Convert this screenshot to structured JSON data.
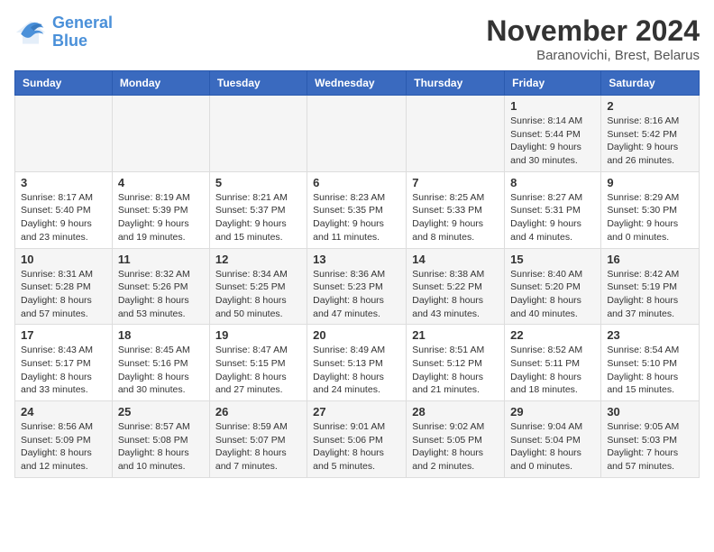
{
  "logo": {
    "line1": "General",
    "line2": "Blue"
  },
  "title": "November 2024",
  "location": "Baranovichi, Brest, Belarus",
  "weekdays": [
    "Sunday",
    "Monday",
    "Tuesday",
    "Wednesday",
    "Thursday",
    "Friday",
    "Saturday"
  ],
  "weeks": [
    [
      {
        "day": "",
        "info": ""
      },
      {
        "day": "",
        "info": ""
      },
      {
        "day": "",
        "info": ""
      },
      {
        "day": "",
        "info": ""
      },
      {
        "day": "",
        "info": ""
      },
      {
        "day": "1",
        "info": "Sunrise: 8:14 AM\nSunset: 5:44 PM\nDaylight: 9 hours\nand 30 minutes."
      },
      {
        "day": "2",
        "info": "Sunrise: 8:16 AM\nSunset: 5:42 PM\nDaylight: 9 hours\nand 26 minutes."
      }
    ],
    [
      {
        "day": "3",
        "info": "Sunrise: 8:17 AM\nSunset: 5:40 PM\nDaylight: 9 hours\nand 23 minutes."
      },
      {
        "day": "4",
        "info": "Sunrise: 8:19 AM\nSunset: 5:39 PM\nDaylight: 9 hours\nand 19 minutes."
      },
      {
        "day": "5",
        "info": "Sunrise: 8:21 AM\nSunset: 5:37 PM\nDaylight: 9 hours\nand 15 minutes."
      },
      {
        "day": "6",
        "info": "Sunrise: 8:23 AM\nSunset: 5:35 PM\nDaylight: 9 hours\nand 11 minutes."
      },
      {
        "day": "7",
        "info": "Sunrise: 8:25 AM\nSunset: 5:33 PM\nDaylight: 9 hours\nand 8 minutes."
      },
      {
        "day": "8",
        "info": "Sunrise: 8:27 AM\nSunset: 5:31 PM\nDaylight: 9 hours\nand 4 minutes."
      },
      {
        "day": "9",
        "info": "Sunrise: 8:29 AM\nSunset: 5:30 PM\nDaylight: 9 hours\nand 0 minutes."
      }
    ],
    [
      {
        "day": "10",
        "info": "Sunrise: 8:31 AM\nSunset: 5:28 PM\nDaylight: 8 hours\nand 57 minutes."
      },
      {
        "day": "11",
        "info": "Sunrise: 8:32 AM\nSunset: 5:26 PM\nDaylight: 8 hours\nand 53 minutes."
      },
      {
        "day": "12",
        "info": "Sunrise: 8:34 AM\nSunset: 5:25 PM\nDaylight: 8 hours\nand 50 minutes."
      },
      {
        "day": "13",
        "info": "Sunrise: 8:36 AM\nSunset: 5:23 PM\nDaylight: 8 hours\nand 47 minutes."
      },
      {
        "day": "14",
        "info": "Sunrise: 8:38 AM\nSunset: 5:22 PM\nDaylight: 8 hours\nand 43 minutes."
      },
      {
        "day": "15",
        "info": "Sunrise: 8:40 AM\nSunset: 5:20 PM\nDaylight: 8 hours\nand 40 minutes."
      },
      {
        "day": "16",
        "info": "Sunrise: 8:42 AM\nSunset: 5:19 PM\nDaylight: 8 hours\nand 37 minutes."
      }
    ],
    [
      {
        "day": "17",
        "info": "Sunrise: 8:43 AM\nSunset: 5:17 PM\nDaylight: 8 hours\nand 33 minutes."
      },
      {
        "day": "18",
        "info": "Sunrise: 8:45 AM\nSunset: 5:16 PM\nDaylight: 8 hours\nand 30 minutes."
      },
      {
        "day": "19",
        "info": "Sunrise: 8:47 AM\nSunset: 5:15 PM\nDaylight: 8 hours\nand 27 minutes."
      },
      {
        "day": "20",
        "info": "Sunrise: 8:49 AM\nSunset: 5:13 PM\nDaylight: 8 hours\nand 24 minutes."
      },
      {
        "day": "21",
        "info": "Sunrise: 8:51 AM\nSunset: 5:12 PM\nDaylight: 8 hours\nand 21 minutes."
      },
      {
        "day": "22",
        "info": "Sunrise: 8:52 AM\nSunset: 5:11 PM\nDaylight: 8 hours\nand 18 minutes."
      },
      {
        "day": "23",
        "info": "Sunrise: 8:54 AM\nSunset: 5:10 PM\nDaylight: 8 hours\nand 15 minutes."
      }
    ],
    [
      {
        "day": "24",
        "info": "Sunrise: 8:56 AM\nSunset: 5:09 PM\nDaylight: 8 hours\nand 12 minutes."
      },
      {
        "day": "25",
        "info": "Sunrise: 8:57 AM\nSunset: 5:08 PM\nDaylight: 8 hours\nand 10 minutes."
      },
      {
        "day": "26",
        "info": "Sunrise: 8:59 AM\nSunset: 5:07 PM\nDaylight: 8 hours\nand 7 minutes."
      },
      {
        "day": "27",
        "info": "Sunrise: 9:01 AM\nSunset: 5:06 PM\nDaylight: 8 hours\nand 5 minutes."
      },
      {
        "day": "28",
        "info": "Sunrise: 9:02 AM\nSunset: 5:05 PM\nDaylight: 8 hours\nand 2 minutes."
      },
      {
        "day": "29",
        "info": "Sunrise: 9:04 AM\nSunset: 5:04 PM\nDaylight: 8 hours\nand 0 minutes."
      },
      {
        "day": "30",
        "info": "Sunrise: 9:05 AM\nSunset: 5:03 PM\nDaylight: 7 hours\nand 57 minutes."
      }
    ]
  ]
}
